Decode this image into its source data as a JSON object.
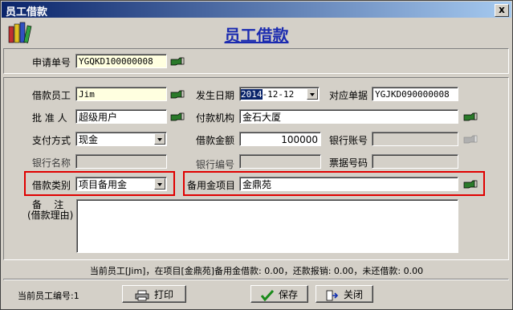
{
  "window": {
    "title": "员工借款",
    "close_glyph": "x"
  },
  "header": {
    "title": "员工借款",
    "icon": "books-icon"
  },
  "form": {
    "application_no": {
      "label": "申请单号",
      "value": "YGQKD100000008"
    },
    "employee": {
      "label": "借款员工",
      "value": "Jim"
    },
    "date": {
      "label": "发生日期",
      "value_sel": "2014",
      "value_rest": "-12-12"
    },
    "ref_doc": {
      "label": "对应单据",
      "value": "YGJKD090000008"
    },
    "approver": {
      "label": "批 准 人",
      "value": "超级用户"
    },
    "pay_org": {
      "label": "付款机构",
      "value": "金石大厦"
    },
    "pay_method": {
      "label": "支付方式",
      "value": "现金"
    },
    "amount": {
      "label": "借款金额",
      "value": "100000"
    },
    "bank_account": {
      "label": "银行账号",
      "value": ""
    },
    "bank_name": {
      "label": "银行名称",
      "value": ""
    },
    "bank_code": {
      "label": "银行编号",
      "value": ""
    },
    "bill_no": {
      "label": "票据号码",
      "value": ""
    },
    "loan_type": {
      "label": "借款类别",
      "value": "项目备用金"
    },
    "reserve_project": {
      "label": "备用金项目",
      "value": "金鼎苑"
    },
    "remark": {
      "label": "备    注",
      "label2": "(借款理由)",
      "value": ""
    }
  },
  "status_text": "当前员工[Jim]，在项目[金鼎苑]备用金借款: 0.00，还款报销: 0.00，未还借款: 0.00",
  "footer": {
    "emp_no_label": "当前员工编号:1"
  },
  "buttons": {
    "print": "打印",
    "save": "保存",
    "close": "关闭"
  },
  "colors": {
    "title_blue": "#1b2bb0",
    "highlight_red": "#e00000",
    "field_yellow": "#ffffe0",
    "titlebar": "#0a246a"
  }
}
